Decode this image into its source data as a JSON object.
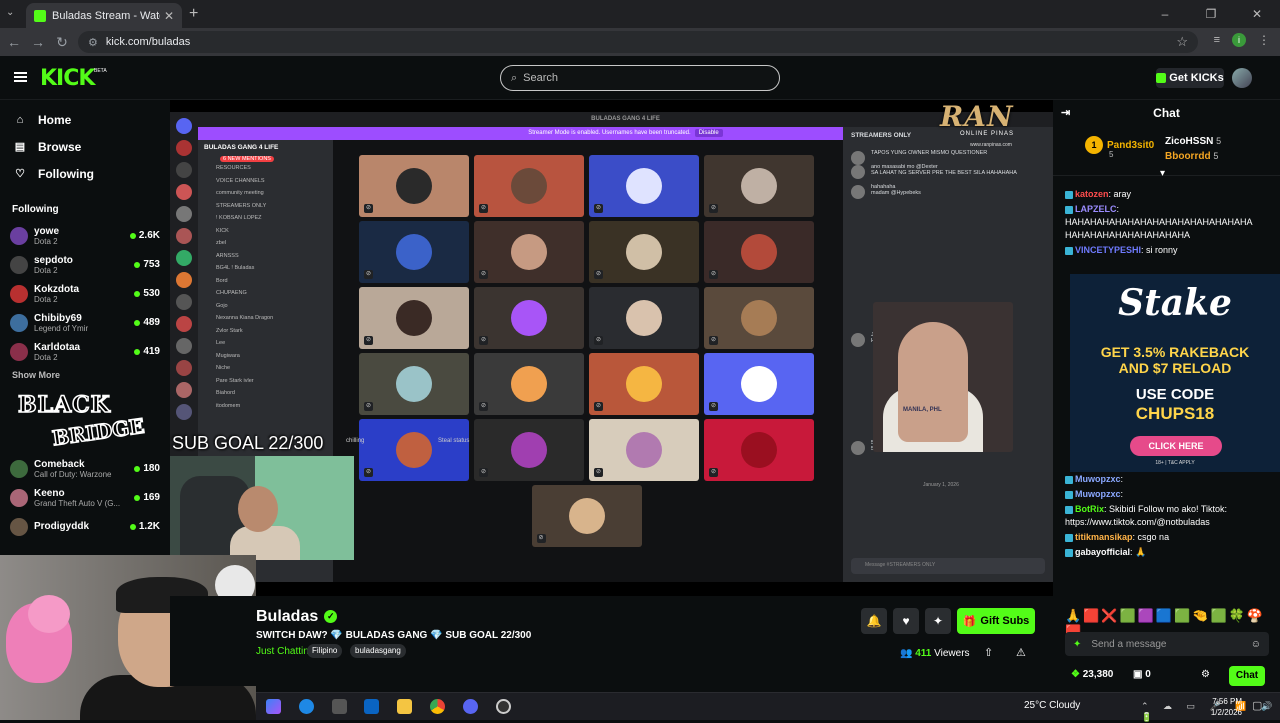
{
  "browser": {
    "tab_title": "Buladas Stream - Watch Live on Kick",
    "url": "kick.com/buladas",
    "window_controls": [
      "–",
      "❐",
      "✕"
    ]
  },
  "header": {
    "logo": "KICK",
    "beta": "BETA",
    "search_placeholder": "Search",
    "get_kicks": "Get KICKs"
  },
  "sidebar": {
    "nav": [
      {
        "label": "Home",
        "icon": "home-icon"
      },
      {
        "label": "Browse",
        "icon": "browse-icon"
      },
      {
        "label": "Following",
        "icon": "heart-icon"
      }
    ],
    "following_heading": "Following",
    "channels": [
      {
        "name": "yowe",
        "game": "Dota 2",
        "viewers": "2.6K",
        "color": "#6a3fa0"
      },
      {
        "name": "sepdoto",
        "game": "Dota 2",
        "viewers": "753",
        "color": "#444"
      },
      {
        "name": "Kokzdota",
        "game": "Dota 2",
        "viewers": "530",
        "color": "#b83030"
      },
      {
        "name": "Chibiby69",
        "game": "Legend of Ymir",
        "viewers": "489",
        "color": "#3d6e9e"
      },
      {
        "name": "Karldotaa",
        "game": "Dota 2",
        "viewers": "419",
        "color": "#8a2f4a"
      }
    ],
    "show_more": "Show More",
    "channels2": [
      {
        "name": "Comeback",
        "game": "Call of Duty: Warzone",
        "viewers": "180",
        "color": "#3d6a3d"
      },
      {
        "name": "Keeno",
        "game": "Grand Theft Auto V (G...",
        "viewers": "169",
        "color": "#aa6677"
      },
      {
        "name": "Prodigyddk",
        "game": "",
        "viewers": "1.2K",
        "color": "#665544"
      }
    ]
  },
  "overlay": {
    "sub_goal": "SUB GOAL 22/300",
    "ran_logo": "RAN",
    "ran_sub": "ONLINE PINAS",
    "ran_url": "www.ranpinas.com",
    "bb_black": "BLACK",
    "bb_bridge": "BRIDGE",
    "chilling": "chilling",
    "steal": "Steal status"
  },
  "discord": {
    "server_title": "BULADAS GANG 4 LIFE",
    "streamer_banner": "Streamer Mode is enabled. Usernames have been truncated.",
    "disable": "Disable",
    "server_name": "BULADAS GANG 4 LIFE",
    "mentions": "6 NEW MENTIONS",
    "channels": [
      "RESOURCES",
      "VOICE CHANNELS",
      "community meeting",
      "STREAMERS ONLY",
      "! KOBSAN LOPEZ",
      "KICK",
      "zbel",
      "ARNSSS",
      "BG4L ! Buladas",
      "Bord",
      "CHUPAENG",
      "Gojo",
      "Nexanna Kiana Dragon",
      "Zvlor Stark",
      "Lee",
      "Mugiwara",
      "Niche",
      "Pare Stark ivler",
      "Biahord",
      "itodomem"
    ],
    "right_header": "STREAMERS ONLY",
    "messages": [
      {
        "u": "TAPOS YUNG OWNER MISMO QUESTIONER",
        "t": ""
      },
      {
        "u": "ano masasabi mo @Dexter",
        "t": "SA LAHAT NG SERVER PRE THE BEST SILA HAHAHAHA"
      },
      {
        "u": "hahahaha",
        "t": "madam @Hypebeks"
      },
      {
        "u": "JOKE LNG PO",
        "t": "HAHAHHAA"
      },
      {
        "u": "500 Michael",
        "t": "500 ivler · 500 bord · 500 kepweng"
      }
    ],
    "date_divider": "January 1, 2026",
    "input": "Message #STREAMERS ONLY",
    "manila": "MANILA, PHL"
  },
  "stream": {
    "name": "Buladas",
    "title": "SWITCH DAW? 💎 BULADAS GANG 💎 SUB GOAL 22/300",
    "category": "Just Chatting",
    "tags": [
      "Filipino",
      "buladasgang"
    ],
    "viewers": "411",
    "viewers_label": "Viewers",
    "gift_subs": "Gift Subs"
  },
  "chat": {
    "title": "Chat",
    "leaders": [
      {
        "rank": "1",
        "name": "Pand3sit0",
        "count": "5"
      },
      {
        "name": "ZicoHSSN",
        "count": "5",
        "color": "#fff"
      },
      {
        "name": "Bboorrdd",
        "count": "5",
        "color": "#f5a623"
      }
    ],
    "messages": [
      {
        "user": "katozen",
        "text": "aray",
        "color": "#ff4d4d"
      },
      {
        "user": "LAPZELC",
        "text": "HAHAHAHAHAHAHAHAHAHAHAHAHAHAHA HAHAHAHAHAHAHAHAHAHA",
        "color": "#9b8cff"
      },
      {
        "user": "VINCETYPESHI",
        "text": "si ronny",
        "color": "#6f7bff"
      }
    ],
    "messages2": [
      {
        "user": "Muwopzxc",
        "text": "",
        "color": "#8aa8ff"
      },
      {
        "user": "Muwopzxc",
        "text": "",
        "color": "#8aa8ff"
      },
      {
        "user": "BotRix",
        "text": "Skibidi Follow mo ako! Tiktok: https://www.tiktok.com/@notbuladas",
        "color": "#53fc18"
      },
      {
        "user": "titikmansikap",
        "text": "csgo na",
        "color": "#ffb347"
      },
      {
        "user": "gabayofficial",
        "text": "🙏",
        "color": "#fff"
      }
    ],
    "ad": {
      "brand": "Stake",
      "line1": "GET 3.5% RAKEBACK",
      "line2": "AND $7 RELOAD",
      "use_code": "USE CODE",
      "code": "CHUPS18",
      "click": "CLICK HERE",
      "fine": "18+ | T&C APPLY"
    },
    "emojis": "🙏🟥❌🟩🟪🟦🟩🤏🟩🍀🍄🟥",
    "send_placeholder": "Send a message",
    "points": "23,380",
    "box_count": "0",
    "chat_button": "Chat"
  },
  "taskbar": {
    "weather": "25°C  Cloudy",
    "time": "7:56 PM",
    "date": "1/2/2026"
  }
}
